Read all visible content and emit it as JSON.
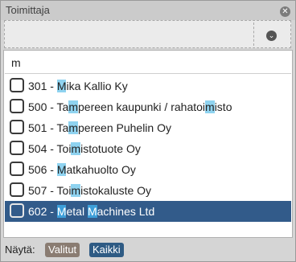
{
  "title": "Toimittaja",
  "icons": {
    "close": "close-icon",
    "dropdown": "chevron-down-icon"
  },
  "search": {
    "value": "m"
  },
  "items": [
    {
      "parts": [
        "301 - ",
        "M",
        "ika Kallio Ky"
      ],
      "selected": false
    },
    {
      "parts": [
        "500 - Ta",
        "m",
        "pereen kaupunki / rahatoi",
        "m",
        "isto"
      ],
      "selected": false
    },
    {
      "parts": [
        "501 - Ta",
        "m",
        "pereen Puhelin Oy"
      ],
      "selected": false
    },
    {
      "parts": [
        "504 - Toi",
        "m",
        "istotuote Oy"
      ],
      "selected": false
    },
    {
      "parts": [
        "506 - ",
        "M",
        "atkahuolto Oy"
      ],
      "selected": false
    },
    {
      "parts": [
        "507 - Toi",
        "m",
        "istokaluste Oy"
      ],
      "selected": false
    },
    {
      "parts": [
        "602 - ",
        "M",
        "etal ",
        "M",
        "achines Ltd"
      ],
      "selected": true
    }
  ],
  "footer": {
    "label": "Näytä:",
    "selected_button": "Valitut",
    "all_button": "Kaikki"
  },
  "colors": {
    "selected_row": "#325b8a",
    "match_highlight": "#8fd3f0",
    "valitut_chip": "#8a7c72",
    "kaikki_chip": "#2f5b84"
  }
}
